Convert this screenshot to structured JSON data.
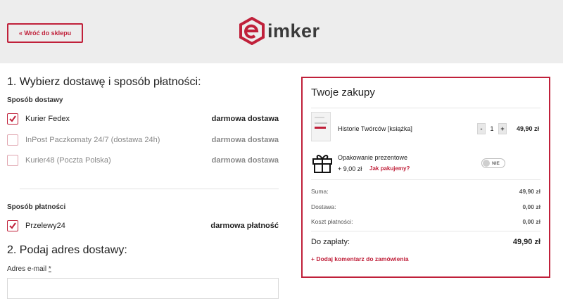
{
  "header": {
    "back_label": "« Wróć do sklepu",
    "logo_text": "imker",
    "brand_color": "#c0203a"
  },
  "shipping": {
    "section_title": "1. Wybierz dostawę i sposób płatności:",
    "delivery_heading": "Sposób dostawy",
    "options": [
      {
        "label": "Kurier Fedex",
        "price": "darmowa dostawa",
        "checked": true
      },
      {
        "label": "InPost Paczkomaty 24/7 (dostawa 24h)",
        "price": "darmowa dostawa",
        "checked": false
      },
      {
        "label": "Kurier48 (Poczta Polska)",
        "price": "darmowa dostawa",
        "checked": false
      }
    ],
    "payment_heading": "Sposób płatności",
    "payment_options": [
      {
        "label": "Przelewy24",
        "price": "darmowa płatność",
        "checked": true
      }
    ]
  },
  "address": {
    "section_title": "2. Podaj adres dostawy:",
    "email_label": "Adres e-mail",
    "required_mark": "*",
    "email_value": ""
  },
  "cart": {
    "title": "Twoje zakupy",
    "item": {
      "name": "Historie Twórców [książka]",
      "quantity": "1",
      "price": "49,90 zł",
      "decrease_label": "-",
      "increase_label": "+"
    },
    "gift": {
      "title": "Opakowanie prezentowe",
      "price": "+ 9,00 zł",
      "link": "Jak pakujemy?",
      "toggle_label": "NIE",
      "enabled": false
    },
    "summary": [
      {
        "label": "Suma:",
        "value": "49,90 zł"
      },
      {
        "label": "Dostawa:",
        "value": "0,00 zł"
      },
      {
        "label": "Koszt płatności:",
        "value": "0,00 zł"
      }
    ],
    "total_label": "Do zapłaty:",
    "total_value": "49,90 zł",
    "comment_link": "+ Dodaj komentarz do zamówienia"
  }
}
